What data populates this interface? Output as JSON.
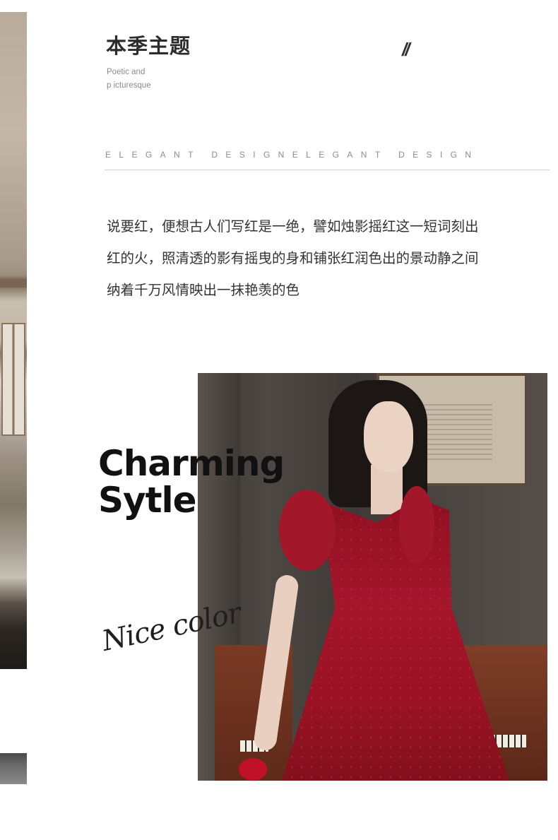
{
  "header": {
    "title": "本季主题",
    "subtitle_line1": "Poetic and",
    "subtitle_line2": "p icturesque",
    "slashes": "//"
  },
  "divider_text": "ELEGANT DESIGNELEGANT DESIGN",
  "poem": {
    "line1": "说要红，便想古人们写红是一绝，譬如烛影摇红这一短词刻出",
    "line2": "红的火，照清透的影有摇曳的身和铺张红润色出的景动静之间",
    "line3": "纳着千万风情映出一抹艳羡的色"
  },
  "feature": {
    "headline_line1": "Charming",
    "headline_line2": "Sytle",
    "script_text": "Nice color"
  },
  "colors": {
    "dress": "#a3172b",
    "text": "#333333"
  }
}
